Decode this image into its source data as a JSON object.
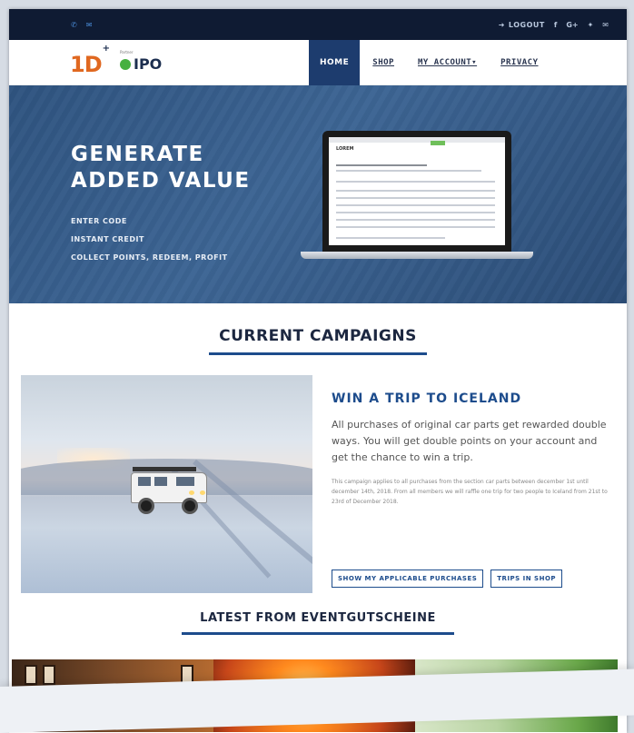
{
  "topbar": {
    "phone_icon": "phone-icon",
    "mail_icon": "mail-icon",
    "logout_label": "LOGOUT",
    "social": [
      "f",
      "G+",
      "twitter",
      "mail"
    ]
  },
  "nav": {
    "logo_text": "1D",
    "logo_plus": "+",
    "partner_logo": "IPO",
    "partner_small": "Partner",
    "items": [
      {
        "label": "HOME"
      },
      {
        "label": "SHOP"
      },
      {
        "label": "MY ACCOUNT▾"
      },
      {
        "label": "PRIVACY"
      }
    ]
  },
  "hero": {
    "title_line1": "GENERATE",
    "title_line2": "ADDED VALUE",
    "items": [
      "ENTER CODE",
      "INSTANT CREDIT",
      "COLLECT POINTS, REDEEM, PROFIT"
    ],
    "screen_title": "LOREM"
  },
  "campaigns": {
    "heading": "CURRENT CAMPAIGNS",
    "title": "WIN A TRIP TO ICELAND",
    "lead": "All purchases of original car parts get rewarded double ways. You will get double points on your account and get the chance to win a trip.",
    "fine": "This campaign applies to all purchases from the section car parts between december 1st until december 14th, 2018. From all members we will raffle one trip for two people to Iceland from 21st to 23rd of December 2018.",
    "btn_purchases": "SHOW MY APPLICABLE PURCHASES",
    "btn_trips": "TRIPS IN SHOP"
  },
  "latest": {
    "heading": "LATEST FROM EVENTGUTSCHEINE"
  }
}
